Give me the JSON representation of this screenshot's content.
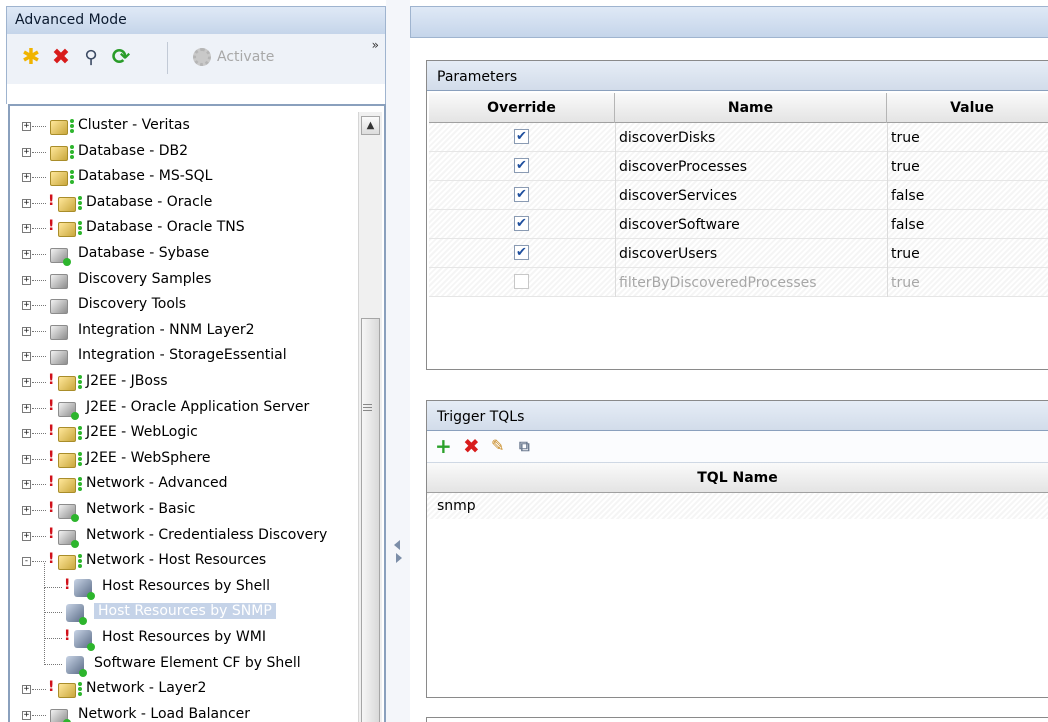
{
  "left_panel": {
    "title": "Advanced Mode",
    "toolbar": {
      "new_icon": "asterisk-new-icon",
      "delete_icon": "red-x-delete-icon",
      "search_icon": "magnifier-search-icon",
      "refresh_icon": "green-refresh-icon",
      "activate_label": "Activate",
      "more_label": "»"
    },
    "tree": [
      {
        "label": "Cluster - Veritas"
      },
      {
        "label": "Database - DB2"
      },
      {
        "label": "Database - MS-SQL"
      },
      {
        "label": "Database - Oracle"
      },
      {
        "label": "Database - Oracle TNS"
      },
      {
        "label": "Database - Sybase"
      },
      {
        "label": "Discovery Samples"
      },
      {
        "label": "Discovery Tools"
      },
      {
        "label": "Integration - NNM Layer2"
      },
      {
        "label": "Integration - StorageEssential"
      },
      {
        "label": "J2EE - JBoss"
      },
      {
        "label": "J2EE - Oracle Application Server"
      },
      {
        "label": "J2EE - WebLogic"
      },
      {
        "label": "J2EE - WebSphere"
      },
      {
        "label": "Network - Advanced"
      },
      {
        "label": "Network - Basic"
      },
      {
        "label": "Network - Credentialess Discovery"
      },
      {
        "label": "Network - Host Resources"
      },
      {
        "label": "Host Resources by Shell"
      },
      {
        "label": "Host Resources by SNMP"
      },
      {
        "label": "Host Resources by WMI"
      },
      {
        "label": "Software Element CF by Shell"
      },
      {
        "label": "Network - Layer2"
      },
      {
        "label": "Network - Load Balancer"
      }
    ],
    "selected_item": "Host Resources by SNMP"
  },
  "parameters": {
    "title": "Parameters",
    "columns": [
      "Override",
      "Name",
      "Value"
    ],
    "rows": [
      {
        "override": true,
        "name": "discoverDisks",
        "value": "true"
      },
      {
        "override": true,
        "name": "discoverProcesses",
        "value": "true"
      },
      {
        "override": true,
        "name": "discoverServices",
        "value": "false"
      },
      {
        "override": true,
        "name": "discoverSoftware",
        "value": "false"
      },
      {
        "override": true,
        "name": "discoverUsers",
        "value": "true"
      },
      {
        "override": false,
        "name": "filterByDiscoveredProcesses",
        "value": "true"
      }
    ]
  },
  "trigger_tqls": {
    "title": "Trigger TQLs",
    "toolbar": {
      "add_icon": "green-plus-add-icon",
      "remove_icon": "red-x-remove-icon",
      "edit_icon": "pencil-edit-icon",
      "view_icon": "tql-view-icon"
    },
    "column": "TQL Name",
    "rows": [
      "snmp"
    ]
  },
  "colors": {
    "header_gradient_top": "#dfe9f6",
    "header_gradient_bottom": "#c5d5ea",
    "selection": "#c5d3e8",
    "error_mark": "#d0101a",
    "status_green": "#2db52d"
  }
}
